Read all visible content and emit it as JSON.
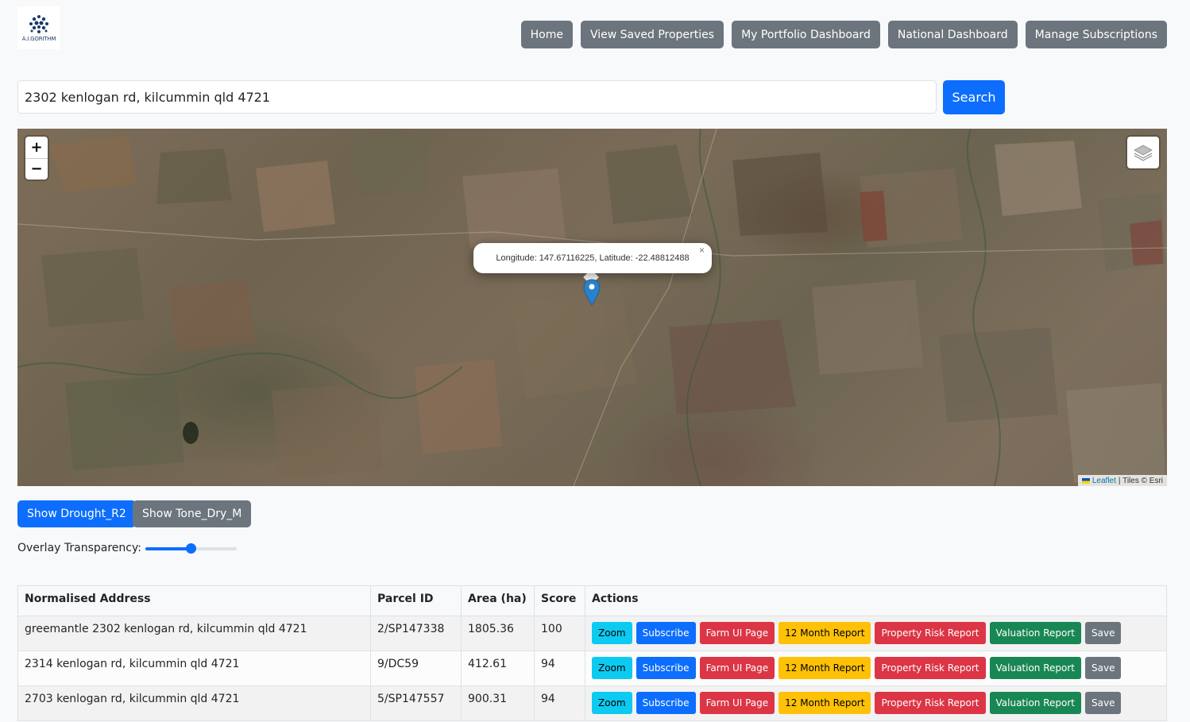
{
  "logo": {
    "text": "A.I.GORITHM"
  },
  "nav": {
    "home": "Home",
    "saved": "View Saved Properties",
    "portfolio": "My Portfolio Dashboard",
    "national": "National Dashboard",
    "subscriptions": "Manage Subscriptions"
  },
  "search": {
    "value": "2302 kenlogan rd, kilcummin qld 4721",
    "button": "Search"
  },
  "map": {
    "zoom_in": "+",
    "zoom_out": "−",
    "popup_text": "Longitude: 147.67116225, Latitude: -22.48812488",
    "popup_close": "×",
    "attribution_link": "Leaflet",
    "attribution_text": "| Tiles © Esri",
    "marker_color": "#2a81cb"
  },
  "overlay": {
    "drought_button": "Show Drought_R2",
    "tone_button": "Show Tone_Dry_M",
    "transparency_label": "Overlay Transparency:",
    "transparency_value": 0.5
  },
  "table": {
    "headers": [
      "Normalised Address",
      "Parcel ID",
      "Area (ha)",
      "Score",
      "Actions"
    ],
    "action_labels": {
      "zoom": "Zoom",
      "subscribe": "Subscribe",
      "farm": "Farm UI Page",
      "month": "12 Month Report",
      "risk": "Property Risk Report",
      "valuation": "Valuation Report",
      "save": "Save"
    },
    "rows": [
      {
        "address": "greemantle 2302 kenlogan rd, kilcummin qld 4721",
        "parcel": "2/SP147338",
        "area": "1805.36",
        "score": "100"
      },
      {
        "address": "2314 kenlogan rd, kilcummin qld 4721",
        "parcel": "9/DC59",
        "area": "412.61",
        "score": "94"
      },
      {
        "address": "2703 kenlogan rd, kilcummin qld 4721",
        "parcel": "5/SP147557",
        "area": "900.31",
        "score": "94"
      }
    ]
  },
  "colors": {
    "primary": "#0d6efd",
    "secondary": "#6c757d",
    "info": "#0dcaf0",
    "danger": "#dc3545",
    "warning": "#ffc107",
    "success": "#198754"
  }
}
